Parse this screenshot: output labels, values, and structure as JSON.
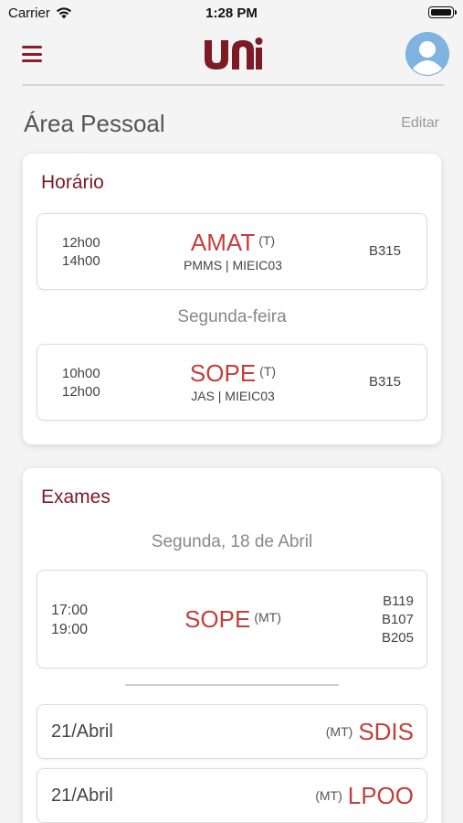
{
  "status_bar": {
    "carrier": "Carrier",
    "time": "1:28 PM"
  },
  "header": {
    "logo": "uni",
    "menu_icon": "hamburger-icon",
    "avatar_icon": "user-avatar-icon"
  },
  "page": {
    "title": "Área Pessoal",
    "edit_label": "Editar"
  },
  "schedule": {
    "title": "Horário",
    "classes": [
      {
        "start": "12h00",
        "end": "14h00",
        "subject": "AMAT",
        "type": "(T)",
        "teacher_class": "PMMS | MIEIC03",
        "room": "B315"
      },
      {
        "start": "10h00",
        "end": "12h00",
        "subject": "SOPE",
        "type": "(T)",
        "teacher_class": "JAS | MIEIC03",
        "room": "B315"
      }
    ],
    "day_label": "Segunda-feira"
  },
  "exams": {
    "title": "Exames",
    "date_heading": "Segunda, 18 de Abril",
    "featured": {
      "start": "17:00",
      "end": "19:00",
      "subject": "SOPE",
      "type": "(MT)",
      "rooms": [
        "B119",
        "B107",
        "B205"
      ]
    },
    "list": [
      {
        "date": "21/Abril",
        "type": "(MT)",
        "subject": "SDIS"
      },
      {
        "date": "21/Abril",
        "type": "(MT)",
        "subject": "LPOO"
      }
    ]
  }
}
